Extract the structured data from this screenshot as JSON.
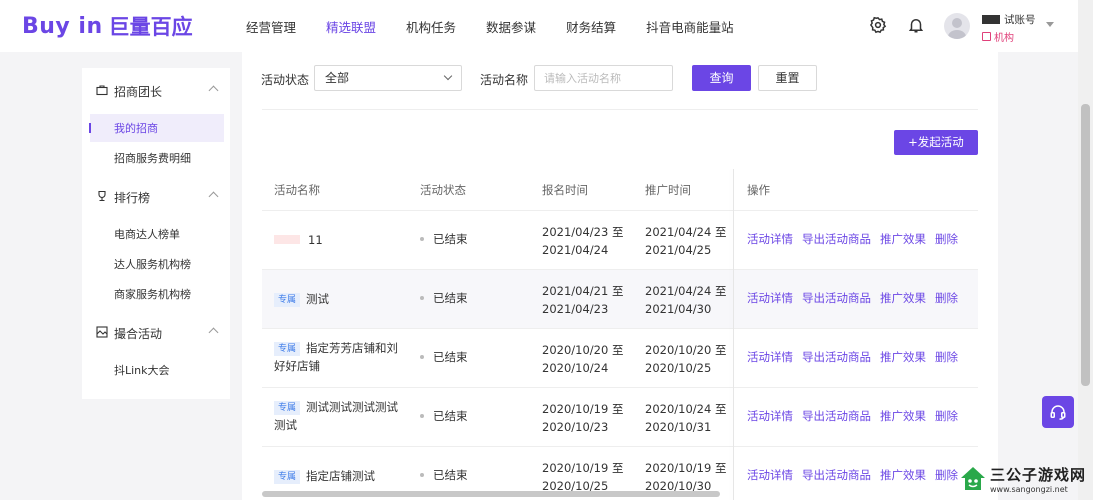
{
  "header": {
    "logo_text": "Buy in",
    "logo_cn": "巨量百应",
    "nav": [
      "经营管理",
      "精选联盟",
      "机构任务",
      "数据参谋",
      "财务结算",
      "抖音电商能量站"
    ],
    "active_nav_index": 1,
    "user_name": "试账号",
    "user_role": "机构",
    "icons": [
      "settings-icon",
      "bell-icon",
      "avatar"
    ]
  },
  "sidebar": {
    "groups": [
      {
        "label": "招商团长",
        "icon": "briefcase-icon",
        "items": [
          "我的招商",
          "招商服务费明细"
        ]
      },
      {
        "label": "排行榜",
        "icon": "trophy-icon",
        "items": [
          "电商达人榜单",
          "达人服务机构榜",
          "商家服务机构榜"
        ]
      },
      {
        "label": "撮合活动",
        "icon": "gallery-icon",
        "items": [
          "抖Link大会"
        ]
      }
    ],
    "active_item": "我的招商"
  },
  "filters": {
    "status_label": "活动状态",
    "status_value": "全部",
    "name_label": "活动名称",
    "name_placeholder": "请输入活动名称",
    "query_button": "查询",
    "reset_button": "重置"
  },
  "launch_button": "+发起活动",
  "table": {
    "headers": [
      "活动名称",
      "活动状态",
      "报名时间",
      "推广时间",
      "操作"
    ],
    "rows": [
      {
        "tag": "",
        "name": "11",
        "status": "已结束",
        "signup_start": "2021/04/23 至",
        "signup_end": "2021/04/24",
        "promo_start": "2021/04/24 至",
        "promo_end": "2021/04/25"
      },
      {
        "tag": "专属",
        "name": "测试",
        "status": "已结束",
        "signup_start": "2021/04/21 至",
        "signup_end": "2021/04/23",
        "promo_start": "2021/04/24 至",
        "promo_end": "2021/04/30"
      },
      {
        "tag": "专属",
        "name": "指定芳芳店铺和刘好好店铺",
        "status": "已结束",
        "signup_start": "2020/10/20 至",
        "signup_end": "2020/10/24",
        "promo_start": "2020/10/20 至",
        "promo_end": "2020/10/25"
      },
      {
        "tag": "专属",
        "name": "测试测试测试测试测试",
        "status": "已结束",
        "signup_start": "2020/10/19 至",
        "signup_end": "2020/10/23",
        "promo_start": "2020/10/24 至",
        "promo_end": "2020/10/31"
      },
      {
        "tag": "专属",
        "name": "指定店铺测试",
        "status": "已结束",
        "signup_start": "2020/10/19 至",
        "signup_end": "2020/10/25",
        "promo_start": "2020/10/19 至",
        "promo_end": "2020/10/30"
      }
    ],
    "ops": [
      "活动详情",
      "导出活动商品",
      "推广效果",
      "删除"
    ]
  },
  "watermark": {
    "title": "三公子游戏网",
    "url": "www.sangongzi.net"
  },
  "colors": {
    "accent": "#6b46e5",
    "tag_bg": "#e6eefc",
    "tag_text": "#3d7be8"
  }
}
